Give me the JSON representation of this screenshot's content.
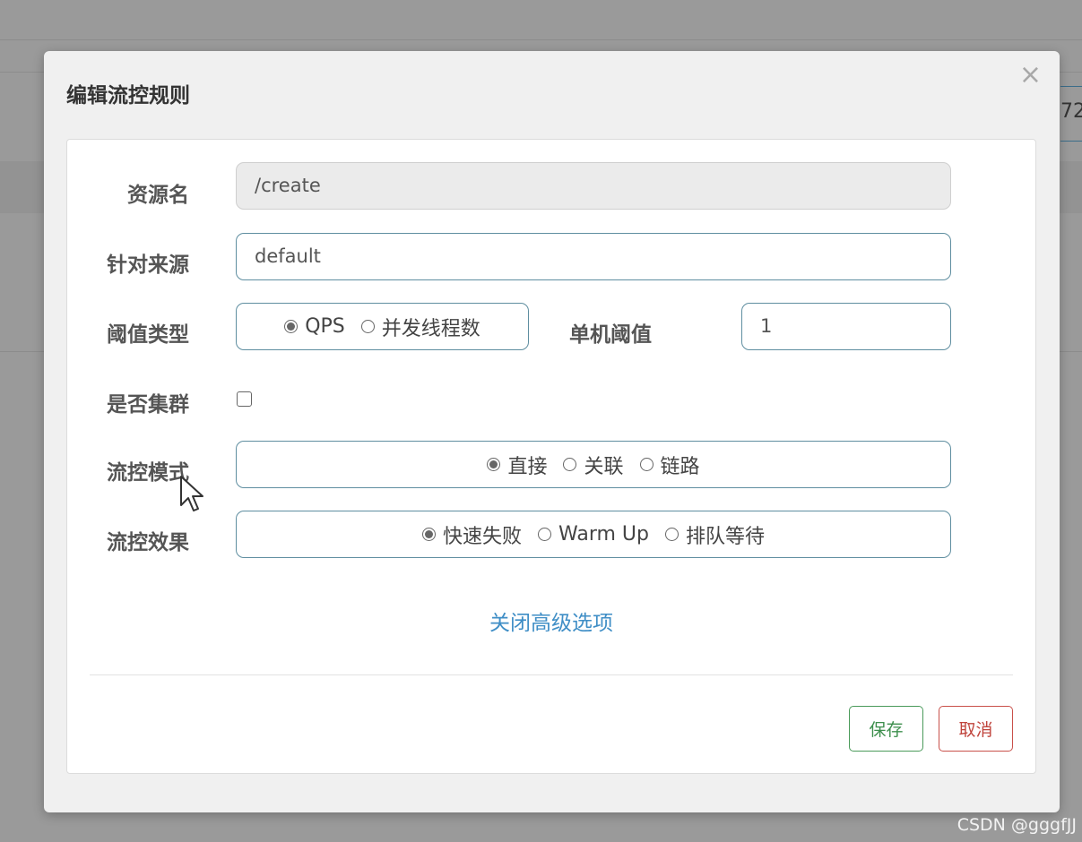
{
  "dialog": {
    "title": "编辑流控规则",
    "close_symbol": "×"
  },
  "form": {
    "resource": {
      "label": "资源名",
      "value": "/create"
    },
    "origin": {
      "label": "针对来源",
      "value": "default"
    },
    "threshold_type": {
      "label": "阈值类型",
      "options": [
        {
          "label": "QPS",
          "checked": true
        },
        {
          "label": "并发线程数",
          "checked": false
        }
      ]
    },
    "single_threshold": {
      "label": "单机阈值",
      "value": "1"
    },
    "cluster": {
      "label": "是否集群",
      "checked": false
    },
    "flow_mode": {
      "label": "流控模式",
      "options": [
        {
          "label": "直接",
          "checked": true
        },
        {
          "label": "关联",
          "checked": false
        },
        {
          "label": "链路",
          "checked": false
        }
      ]
    },
    "flow_effect": {
      "label": "流控效果",
      "options": [
        {
          "label": "快速失败",
          "checked": true
        },
        {
          "label": "Warm Up",
          "checked": false
        },
        {
          "label": "排队等待",
          "checked": false
        }
      ]
    },
    "advanced_link": "关闭高级选项"
  },
  "footer": {
    "save_label": "保存",
    "cancel_label": "取消"
  },
  "background": {
    "partial_text": "72"
  },
  "watermark": "CSDN @gggfJJ",
  "colors": {
    "save": "#3d8f4d",
    "cancel": "#c0443c",
    "link": "#3f8ec6",
    "input_border": "#5f8ea0"
  }
}
